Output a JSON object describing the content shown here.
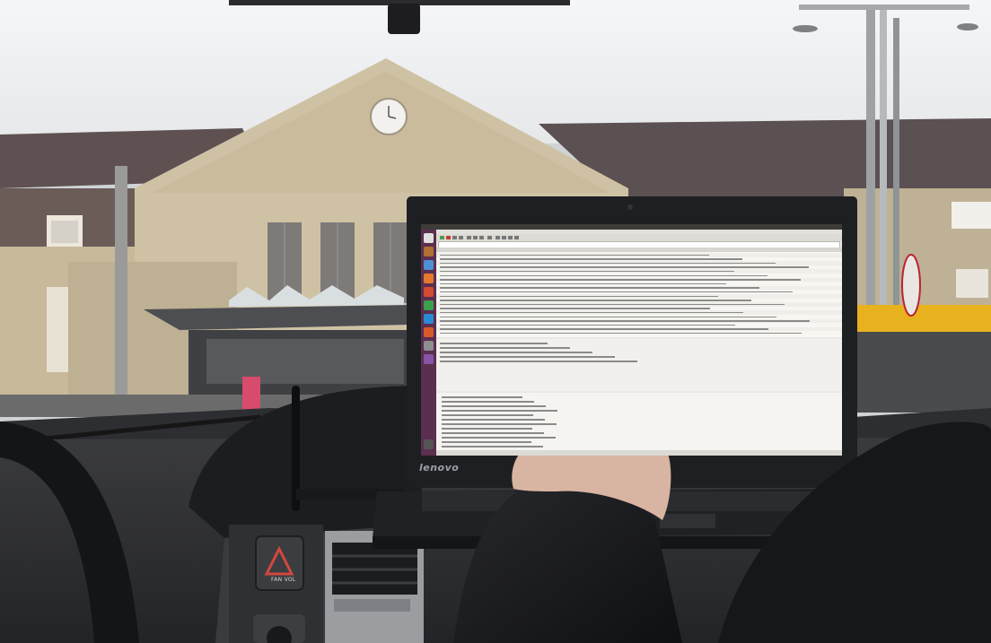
{
  "scene": {
    "description_tags": [
      "car-interior",
      "laptop",
      "train-station"
    ],
    "colors": {
      "sky": "#f1f2f3",
      "roof": "#5d5152",
      "facade": "#cdbf9f",
      "dashboard": "#2c2d30",
      "laptop": "#1e1f22",
      "launcher": "#5a2f4f",
      "jacket": "#17181a"
    }
  },
  "laptop": {
    "brand": "lenovo",
    "app_icons": [
      "dash-icon",
      "files-icon",
      "browser-icon",
      "firefox-icon",
      "settings-icon",
      "terminal-icon",
      "skype-icon",
      "text-editor-icon",
      "software-center-icon",
      "workspace-icon",
      "trash-icon"
    ],
    "launcher_icon_colors": [
      "#e0e0e0",
      "#b07033",
      "#4f8fd6",
      "#e5782b",
      "#d24a32",
      "#3aa04a",
      "#2a8bd4",
      "#d65a2a",
      "#8e8e8e",
      "#8555a8",
      "#555555"
    ]
  },
  "dashboard": {
    "button_label": "FAN VOL"
  }
}
